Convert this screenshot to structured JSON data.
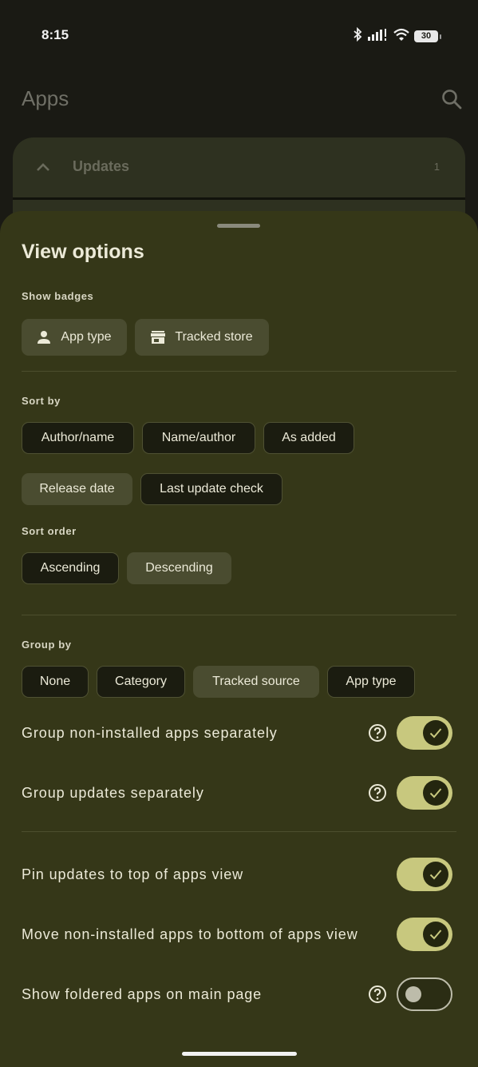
{
  "status_bar": {
    "time": "8:15",
    "battery": "30"
  },
  "app_bar": {
    "title": "Apps"
  },
  "updates_group": {
    "label": "Updates",
    "count": "1"
  },
  "sheet": {
    "title": "View options",
    "show_badges": {
      "label": "Show badges",
      "chips": [
        {
          "label": "App type",
          "selected": true
        },
        {
          "label": "Tracked store",
          "selected": true
        }
      ]
    },
    "sort_by": {
      "label": "Sort by",
      "chips": [
        {
          "label": "Author/name",
          "selected": false
        },
        {
          "label": "Name/author",
          "selected": false
        },
        {
          "label": "As added",
          "selected": false
        },
        {
          "label": "Release date",
          "selected": true
        },
        {
          "label": "Last update check",
          "selected": false
        }
      ]
    },
    "sort_order": {
      "label": "Sort order",
      "chips": [
        {
          "label": "Ascending",
          "selected": false
        },
        {
          "label": "Descending",
          "selected": true
        }
      ]
    },
    "group_by": {
      "label": "Group by",
      "chips": [
        {
          "label": "None",
          "selected": false
        },
        {
          "label": "Category",
          "selected": false
        },
        {
          "label": "Tracked source",
          "selected": true
        },
        {
          "label": "App type",
          "selected": false
        }
      ]
    },
    "toggles": [
      {
        "label": "Group non-installed apps separately",
        "on": true,
        "help": true
      },
      {
        "label": "Group updates separately",
        "on": true,
        "help": true
      },
      {
        "label": "Pin updates to top of apps view",
        "on": true,
        "help": false
      },
      {
        "label": "Move non-installed apps to bottom of apps view",
        "on": true,
        "help": false
      },
      {
        "label": "Show foldered apps on main page",
        "on": false,
        "help": true
      }
    ]
  },
  "colors": {
    "sheet_bg": "#353718",
    "toggle_on": "#c8c87e",
    "chip_selected": "#4a4c30"
  }
}
